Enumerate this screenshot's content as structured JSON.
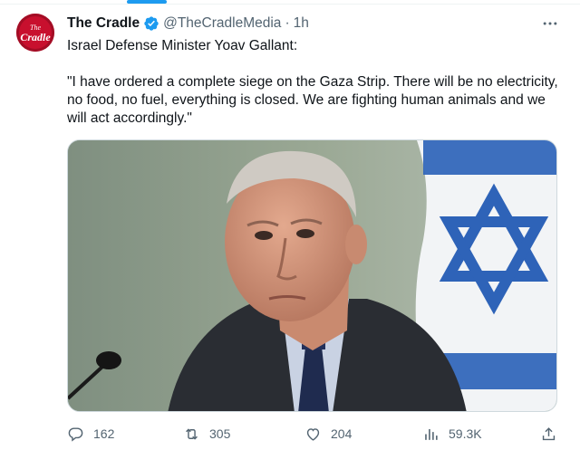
{
  "author": {
    "display_name": "The Cradle",
    "handle": "@TheCradleMedia",
    "separator": "·",
    "time": "1h",
    "avatar_text_small": "The",
    "avatar_text": "Cradle"
  },
  "tweet": {
    "line1": "Israel Defense Minister Yoav Gallant:",
    "line2": "\"I have ordered a complete siege on the Gaza Strip. There will be no electricity, no food, no fuel, everything is closed. We are fighting human animals and we will act accordingly.\""
  },
  "actions": {
    "replies": "162",
    "reposts": "305",
    "likes": "204",
    "views": "59.3K"
  },
  "icons": {
    "verified": "verified-badge-icon",
    "more": "more-icon",
    "reply": "reply-icon",
    "repost": "repost-icon",
    "like": "heart-icon",
    "views": "views-icon",
    "share": "share-icon"
  },
  "colors": {
    "accent": "#1d9bf0",
    "avatar_red": "#c8102e",
    "muted_text": "#536471"
  }
}
